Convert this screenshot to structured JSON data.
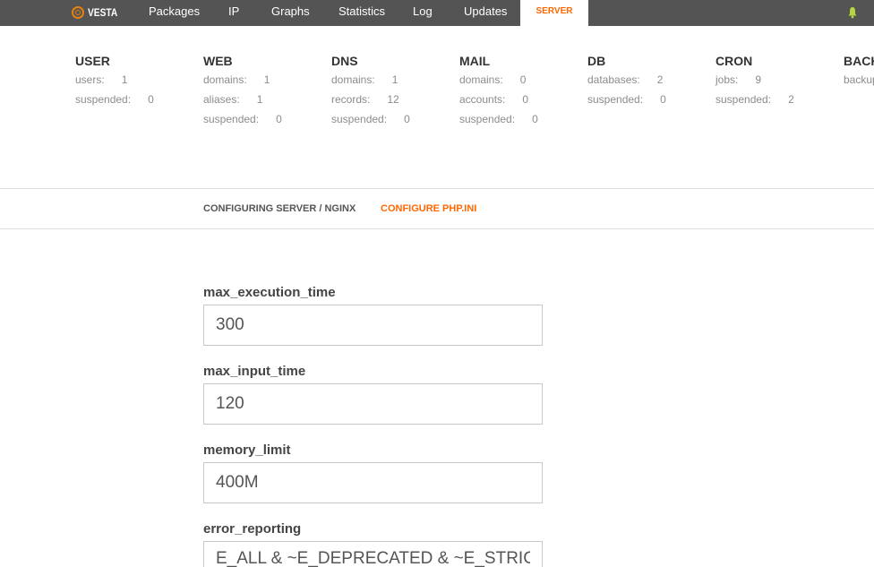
{
  "nav": {
    "logo": "VESTA",
    "items": [
      "Packages",
      "IP",
      "Graphs",
      "Statistics",
      "Log",
      "Updates"
    ],
    "active": "SERVER"
  },
  "stats": {
    "user": {
      "title": "USER",
      "rows": [
        {
          "label": "users:",
          "value": "1"
        },
        {
          "label": "suspended:",
          "value": "0"
        }
      ]
    },
    "web": {
      "title": "WEB",
      "rows": [
        {
          "label": "domains:",
          "value": "1"
        },
        {
          "label": "aliases:",
          "value": "1"
        },
        {
          "label": "suspended:",
          "value": "0"
        }
      ]
    },
    "dns": {
      "title": "DNS",
      "rows": [
        {
          "label": "domains:",
          "value": "1"
        },
        {
          "label": "records:",
          "value": "12"
        },
        {
          "label": "suspended:",
          "value": "0"
        }
      ]
    },
    "mail": {
      "title": "MAIL",
      "rows": [
        {
          "label": "domains:",
          "value": "0"
        },
        {
          "label": "accounts:",
          "value": "0"
        },
        {
          "label": "suspended:",
          "value": "0"
        }
      ]
    },
    "db": {
      "title": "DB",
      "rows": [
        {
          "label": "databases:",
          "value": "2"
        },
        {
          "label": "suspended:",
          "value": "0"
        }
      ]
    },
    "cron": {
      "title": "CRON",
      "rows": [
        {
          "label": "jobs:",
          "value": "9"
        },
        {
          "label": "suspended:",
          "value": "2"
        }
      ]
    },
    "backup": {
      "title": "BACKUP",
      "rows": [
        {
          "label": "backups:",
          "value": ""
        }
      ]
    }
  },
  "breadcrumb": {
    "section": "CONFIGURING SERVER / NGINX",
    "link": "CONFIGURE PHP.INI"
  },
  "form": {
    "fields": [
      {
        "label": "max_execution_time",
        "value": "300"
      },
      {
        "label": "max_input_time",
        "value": "120"
      },
      {
        "label": "memory_limit",
        "value": "400M"
      },
      {
        "label": "error_reporting",
        "value": "E_ALL & ~E_DEPRECATED & ~E_STRICT"
      }
    ]
  },
  "colors": {
    "accent": "#ff6701",
    "topbar": "#545454",
    "notification": "#b4d641"
  }
}
